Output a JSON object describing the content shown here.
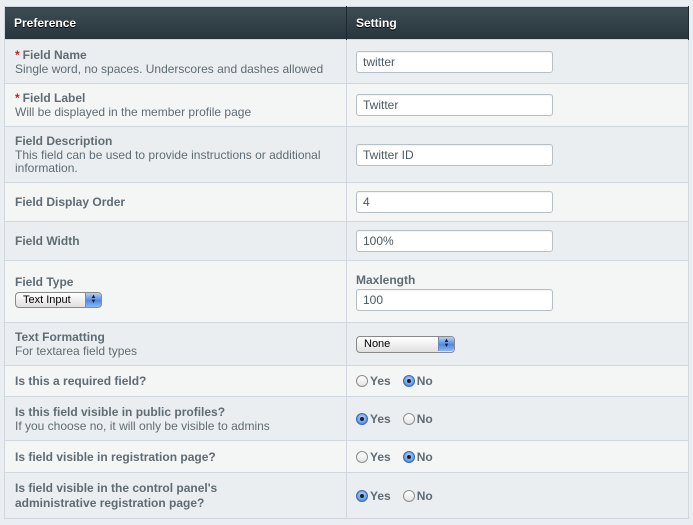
{
  "header": {
    "preference": "Preference",
    "setting": "Setting"
  },
  "rows": {
    "field_name": {
      "required_marker": "*",
      "label": "Field Name",
      "description": "Single word, no spaces. Underscores and dashes allowed",
      "value": "twitter"
    },
    "field_label": {
      "required_marker": "*",
      "label": "Field Label",
      "description": "Will be displayed in the member profile page",
      "value": "Twitter"
    },
    "field_description": {
      "label": "Field Description",
      "description": "This field can be used to provide instructions or additional information.",
      "value": "Twitter ID"
    },
    "field_display_order": {
      "label": "Field Display Order",
      "value": "4"
    },
    "field_width": {
      "label": "Field Width",
      "value": "100%"
    },
    "field_type": {
      "label": "Field Type",
      "selected": "Text Input",
      "maxlength_label": "Maxlength",
      "maxlength_value": "100"
    },
    "text_formatting": {
      "label": "Text Formatting",
      "description": "For textarea field types",
      "selected": "None"
    },
    "required_field": {
      "label": "Is this a required field?",
      "yes_label": "Yes",
      "no_label": "No",
      "selected": "No"
    },
    "public_profiles": {
      "label": "Is this field visible in public profiles?",
      "description": "If you choose no, it will only be visible to admins",
      "yes_label": "Yes",
      "no_label": "No",
      "selected": "Yes"
    },
    "registration_page": {
      "label": "Is field visible in registration page?",
      "yes_label": "Yes",
      "no_label": "No",
      "selected": "No"
    },
    "cp_registration_page": {
      "label": "Is field visible in the control panel's administrative registration page?",
      "yes_label": "Yes",
      "no_label": "No",
      "selected": "Yes"
    }
  },
  "colors": {
    "header_bg": "#2f3d44",
    "required_marker": "#c0202d",
    "radio_selected": "#5a92e0"
  }
}
